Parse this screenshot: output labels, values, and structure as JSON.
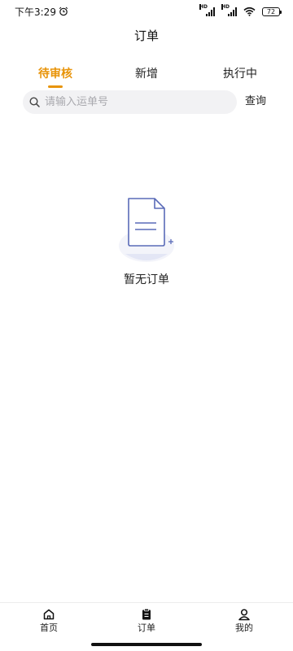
{
  "status_bar": {
    "time": "下午3:29",
    "battery": "72"
  },
  "header": {
    "title": "订单"
  },
  "tabs": [
    {
      "label": "待审核",
      "active": true
    },
    {
      "label": "新增",
      "active": false
    },
    {
      "label": "执行中",
      "active": false
    }
  ],
  "search": {
    "placeholder": "请输入运单号",
    "button_label": "查询"
  },
  "empty_state": {
    "text": "暂无订单"
  },
  "bottom_nav": {
    "items": [
      {
        "label": "首页",
        "icon": "home-icon"
      },
      {
        "label": "订单",
        "icon": "order-icon"
      },
      {
        "label": "我的",
        "icon": "profile-icon"
      }
    ]
  },
  "colors": {
    "accent": "#e8940a",
    "illustration": "#5a6bb8"
  }
}
